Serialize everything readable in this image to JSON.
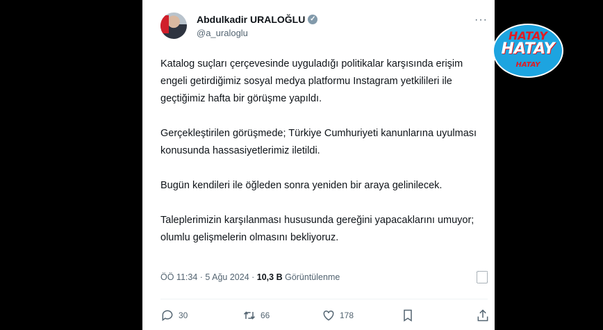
{
  "tweet": {
    "author_name": "Abdulkadir URALOĞLU",
    "handle": "@a_uraloglu",
    "paragraphs": [
      "Katalog suçları çerçevesinde uyguladığı politikalar karşısında erişim engeli getirdiğimiz sosyal medya platformu Instagram yetkilileri ile geçtiğimiz hafta bir görüşme yapıldı.",
      "Gerçekleştirilen görüşmede; Türkiye Cumhuriyeti kanunlarına uyulması konusunda hassasiyetlerimiz iletildi.",
      "Bugün kendileri ile öğleden sonra yeniden bir araya gelinilecek.",
      "Taleplerimizin karşılanması hususunda gereğini yapacaklarını umuyor; olumlu gelişmelerin olmasını bekliyoruz."
    ],
    "time": "ÖÖ 11:34",
    "date": "5 Ağu 2024",
    "views_count": "10,3 B",
    "views_label": "Görüntülenme"
  },
  "actions": {
    "reply_count": "30",
    "retweet_count": "66",
    "like_count": "178"
  },
  "logo": {
    "line1": "HATAY",
    "line2": "HATAY",
    "line3": "HATAY"
  },
  "colors": {
    "accent": "#1da4e0",
    "text": "#0f1419",
    "muted": "#536471",
    "logo_red": "#e11b22"
  },
  "icons": [
    "verified-badge-icon",
    "more-icon",
    "analytics-icon",
    "reply-icon",
    "retweet-icon",
    "like-icon",
    "bookmark-icon",
    "share-icon"
  ]
}
